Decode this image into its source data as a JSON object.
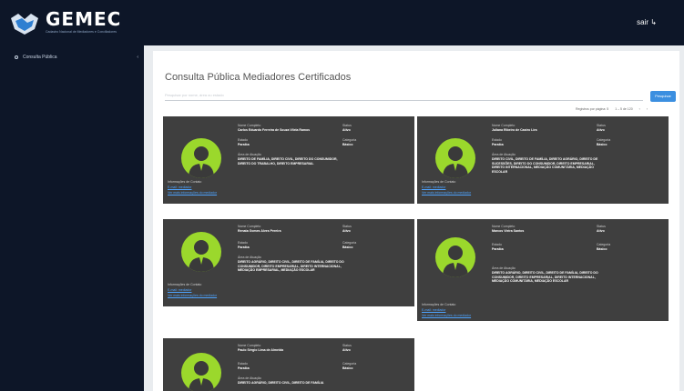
{
  "app": {
    "logo_text": "GEMEC",
    "logo_sub": "Cadastro Nacional de Mediadores e Conciliadores",
    "user_label": "sair"
  },
  "sidebar": {
    "items": [
      {
        "label": "Consulta Pública"
      }
    ]
  },
  "page": {
    "title": "Consulta Pública Mediadores Certificados",
    "search_placeholder": "Pesquisar por nome, área ou estado",
    "search_button": "Pesquisar"
  },
  "pager": {
    "text": "Registros por página: 5",
    "range": "1 – 5 de 120",
    "prev": "‹",
    "next": "›"
  },
  "labels": {
    "name": "Nome Completo",
    "status": "Status",
    "state": "Estado",
    "category": "Categoria",
    "areas": "Área de Atuação",
    "info": "Informações de Contato",
    "email": "E-mail: mediador",
    "more": "Ver mais informações do mediador"
  },
  "cards": [
    {
      "name": "Carlos Eduardo Ferreira de Souza Vilela Ramos",
      "status": "Ativo",
      "state": "Paraíba",
      "category": "Básico",
      "areas": "DIREITO DE FAMÍLIA, DIREITO CIVIL, DIREITO DO CONSUMIDOR, DIREITO DO TRABALHO, DIREITO EMPRESARIAL"
    },
    {
      "name": "Juliana Ribeiro de Castro Lira",
      "status": "Ativo",
      "state": "Paraíba",
      "category": "Básico",
      "areas": "DIREITO CIVIL, DIREITO DE FAMÍLIA, DIREITO AGRÁRIO, DIREITO DE SUCESSÕES, DIREITO DO CONSUMIDOR, DIREITO EMPRESARIAL, DIREITO INTERNACIONAL, MEDIAÇÃO COMUNITÁRIA, MEDIAÇÃO ESCOLAR"
    },
    {
      "name": "Renata Gomes Alves Pereira",
      "status": "Ativo",
      "state": "Paraíba",
      "category": "Básico",
      "areas": "DIREITO AGRÁRIO, DIREITO CIVIL, DIREITO DE FAMÍLIA, DIREITO DO CONSUMIDOR, DIREITO EMPRESARIAL, DIREITO INTERNACIONAL, MEDIAÇÃO EMPRESARIAL, MEDIAÇÃO ESCOLAR"
    },
    {
      "name": "Marcos Vieira Santos",
      "status": "Ativo",
      "state": "Paraíba",
      "category": "Básico",
      "areas": "DIREITO AGRÁRIO, DIREITO CIVIL, DIREITO DE FAMÍLIA, DIREITO DO CONSUMIDOR, DIREITO EMPRESARIAL, DIREITO INTERNACIONAL, MEDIAÇÃO COMUNITÁRIA, MEDIAÇÃO ESCOLAR"
    },
    {
      "name": "Paulo Sérgio Lima de Almeida",
      "status": "Ativo",
      "state": "Paraíba",
      "category": "Básico",
      "areas": "DIREITO AGRÁRIO, DIREITO CIVIL, DIREITO DE FAMÍLIA"
    }
  ]
}
